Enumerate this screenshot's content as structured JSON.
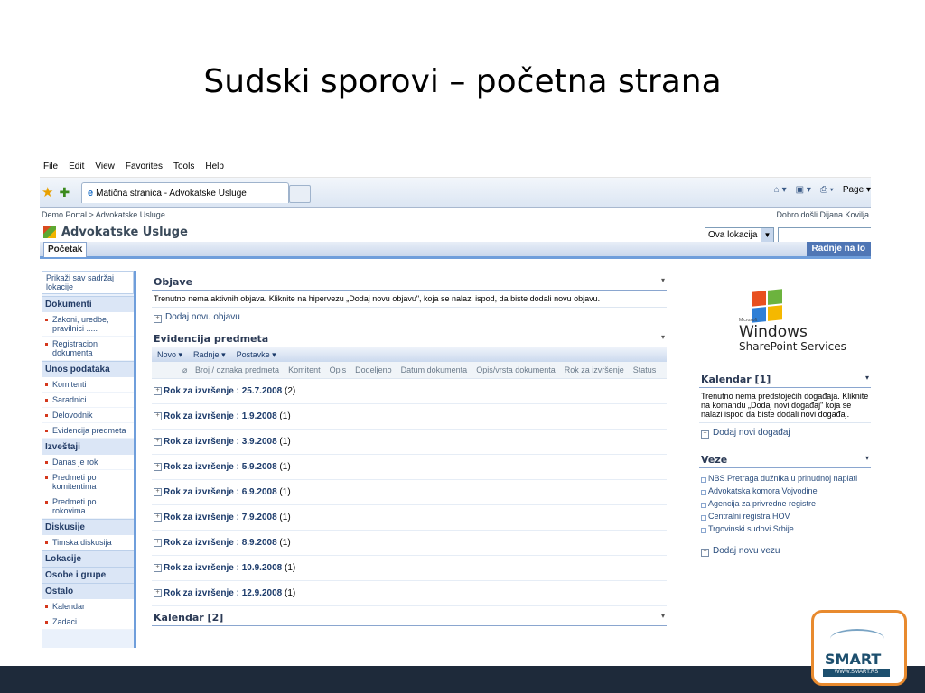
{
  "slide": {
    "title": "Sudski sporovi – početna strana"
  },
  "browser": {
    "menu": [
      "File",
      "Edit",
      "View",
      "Favorites",
      "Tools",
      "Help"
    ],
    "tab_title": "Matična stranica - Advokatske Usluge",
    "page_label": "Page"
  },
  "portal": {
    "breadcrumb": "Demo Portal > Advokatske Usluge",
    "welcome": "Dobro došli Dijana Kovilja",
    "site_title": "Advokatske Usluge",
    "search_scope": "Ova lokacija",
    "home_tab": "Početak",
    "actions": "Radnje na lo"
  },
  "quick_launch": {
    "top": "Prikaži sav sadržaj lokacije",
    "sections": [
      {
        "title": "Dokumenti",
        "items": [
          "Zakoni, uredbe, pravilnici .....",
          "Registracion dokumenta"
        ]
      },
      {
        "title": "Unos podataka",
        "items": [
          "Komitenti",
          "Saradnici",
          "Delovodnik",
          "Evidencija predmeta"
        ]
      },
      {
        "title": "Izveštaji",
        "items": [
          "Danas je rok",
          "Predmeti po komitentima",
          "Predmeti po rokovima"
        ]
      },
      {
        "title": "Diskusije",
        "items": [
          "Timska diskusija"
        ]
      },
      {
        "title": "Lokacije",
        "items": []
      },
      {
        "title": "Osobe i grupe",
        "items": []
      },
      {
        "title": "Ostalo",
        "items": [
          "Kalendar",
          "Zadaci"
        ]
      }
    ]
  },
  "main": {
    "announcements": {
      "title": "Objave",
      "text": "Trenutno nema aktivnih objava. Kliknite na hipervezu „Dodaj novu objavu\", koja se nalazi ispod, da biste dodali novu objavu.",
      "add": "Dodaj novu objavu"
    },
    "cases": {
      "title": "Evidencija predmeta",
      "toolbar": [
        "Novo",
        "Radnje",
        "Postavke"
      ],
      "columns": [
        "Broj / oznaka predmeta",
        "Komitent",
        "Opis",
        "Dodeljeno",
        "Datum dokumenta",
        "Opis/vrsta dokumenta",
        "Rok za izvršenje",
        "Status"
      ],
      "group_label": "Rok za izvršenje",
      "groups": [
        {
          "date": "25.7.2008",
          "count": "(2)"
        },
        {
          "date": "1.9.2008",
          "count": "(1)"
        },
        {
          "date": "3.9.2008",
          "count": "(1)"
        },
        {
          "date": "5.9.2008",
          "count": "(1)"
        },
        {
          "date": "6.9.2008",
          "count": "(1)"
        },
        {
          "date": "7.9.2008",
          "count": "(1)"
        },
        {
          "date": "8.9.2008",
          "count": "(1)"
        },
        {
          "date": "10.9.2008",
          "count": "(1)"
        },
        {
          "date": "12.9.2008",
          "count": "(1)"
        }
      ]
    },
    "calendar2": {
      "title": "Kalendar [2]"
    }
  },
  "right": {
    "logo_line1": "Windows",
    "logo_line2": "SharePoint Services",
    "logo_small": "Microsoft",
    "calendar": {
      "title": "Kalendar [1]",
      "text": "Trenutno nema predstojećih događaja. Kliknite na komandu „Dodaj novi događaj\" koja se nalazi ispod da biste dodali novi događaj.",
      "add": "Dodaj novi događaj"
    },
    "links": {
      "title": "Veze",
      "items": [
        "NBS Pretraga dužnika u prinudnoj naplati",
        "Advokatska komora Vojvodine",
        "Agencija za privredne registre",
        "Centralni registra HOV",
        "Trgovinski sudovi Srbije"
      ],
      "add": "Dodaj novu vezu"
    }
  },
  "branding": {
    "name": "SMART",
    "url": "WWW.SMART.RS"
  }
}
